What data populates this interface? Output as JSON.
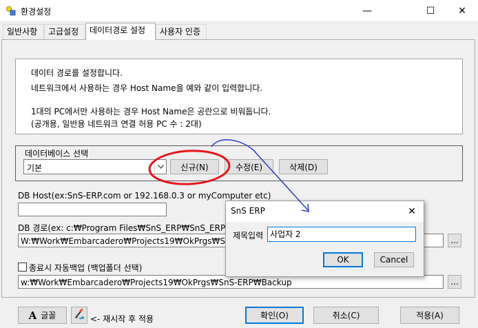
{
  "window": {
    "title": "환경설정",
    "minimize": "—",
    "maximize": "☐",
    "close": "✕"
  },
  "tabs": [
    {
      "label": "일반사항"
    },
    {
      "label": "고급설정"
    },
    {
      "label": "데이터경로 설정"
    },
    {
      "label": "사용자 인증"
    }
  ],
  "info": {
    "lines": [
      "데이터 경로를 설정합니다.",
      "네트워크에서 사용하는 경우 Host Name을 예와 같이 입력합니다.",
      "1대의 PC에서만 사용하는 경우 Host Name은 공란으로 비워둡니다.",
      " (공개용, 일반용 네트워크 연결 허용 PC 수 : 2대)"
    ]
  },
  "db_select": {
    "label": "데이터베이스 선택",
    "value": "기본",
    "new_button": "신규(N)",
    "edit_button": "수정(E)",
    "delete_button": "삭제(D)"
  },
  "db_host": {
    "label": "DB Host(ex:SnS-ERP.com or 192.168.0.3 or myComputer etc)",
    "value": ""
  },
  "db_path": {
    "label": "DB 경로(ex: c:₩Program Files₩SnS_ERP₩SnS_ERP₩Data",
    "value": "W:₩Work₩Embarcadero₩Projects19₩OkPrgs₩SnS-ERP₩",
    "browse": "..."
  },
  "backup": {
    "checkbox_label": "종료시 자동백업 (백업폴더 선택)",
    "checked": false,
    "value": "w:₩Work₩Embarcadero₩Projects19₩OkPrgs₩SnS-ERP₩Backup",
    "browse": "..."
  },
  "bottom": {
    "font_button": "글꼴",
    "restart_note": "<- 재시작 후 적용",
    "ok_button": "확인(O)",
    "cancel_button": "취소(C)",
    "apply_button": "적용(A)"
  },
  "dialog": {
    "title": "SnS ERP",
    "close": "✕",
    "field_label": "제목입력",
    "field_value": "사업자 2",
    "ok_button": "OK",
    "cancel_button": "Cancel"
  },
  "colors": {
    "annotation_ellipse": "#e8141b",
    "annotation_arrow": "#3344c4",
    "focus_border": "#0078d7"
  },
  "icons": {
    "app": "settings-app-icon",
    "font": "font-A-icon",
    "brush": "paint-brush-icon"
  }
}
